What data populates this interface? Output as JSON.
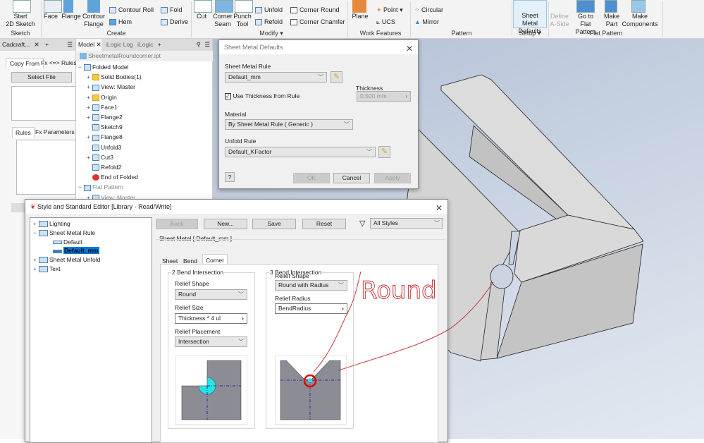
{
  "ribbon": {
    "sketch": {
      "start_label": "Start",
      "start_label2": "2D Sketch",
      "group": "Sketch"
    },
    "create": {
      "face": "Face",
      "flange": "Flange",
      "contour_flange": "Contour",
      "contour_flange2": "Flange",
      "contour_roll": "Contour Roll",
      "hem": "Hem",
      "fold": "Fold",
      "derive": "Derive",
      "group": "Create"
    },
    "modify": {
      "cut": "Cut",
      "corner_seam": "Corner",
      "corner_seam2": "Seam",
      "punch_tool": "Punch",
      "punch_tool2": "Tool",
      "unfold": "Unfold",
      "refold": "Refold",
      "corner_round": "Corner Round",
      "corner_chamfer": "Corner Chamfer",
      "group": "Modify ▾"
    },
    "work_features": {
      "plane": "Plane",
      "point": "Point",
      "ucs": "UCS",
      "group": "Work Features"
    },
    "pattern": {
      "circular": "Circular",
      "mirror": "Mirror",
      "group": "Pattern"
    },
    "setup": {
      "sheet_metal_defaults": "Sheet Metal",
      "sheet_metal_defaults2": "Defaults",
      "group": "Setup ▾"
    },
    "flat_pattern": {
      "define_a_side": "Define",
      "define_a_side2": "A-Side",
      "go_to": "Go to",
      "go_to2": "Flat Pattern",
      "make_part": "Make",
      "make_part2": "Part",
      "make_components": "Make",
      "make_components2": "Components",
      "group": "Flat Pattern"
    }
  },
  "left_panel": {
    "tab": "Cadcraft...",
    "copy_from": "Copy From",
    "fx_rules": "Fx <=> Rules",
    "select_file": "Select File",
    "rules": "Rules",
    "fx_parameters": "Fx Parameters"
  },
  "model_panel": {
    "tabs": [
      "Model",
      "iLogic Log",
      "iLogic"
    ],
    "file": "SheetmetalRoundcorner.ipt",
    "items": [
      {
        "pm": "−",
        "label": "Folded Model"
      },
      {
        "pm": "+",
        "label": "Solid Bodies(1)"
      },
      {
        "pm": "+",
        "label": "View: Master"
      },
      {
        "pm": "+",
        "label": "Origin"
      },
      {
        "pm": "+",
        "label": "Face1"
      },
      {
        "pm": "+",
        "label": "Flange2"
      },
      {
        "pm": "",
        "label": "Sketch9"
      },
      {
        "pm": "+",
        "label": "Flange8"
      },
      {
        "pm": "",
        "label": "Unfold3"
      },
      {
        "pm": "+",
        "label": "Cut3"
      },
      {
        "pm": "",
        "label": "Refold2"
      },
      {
        "pm": "",
        "label": "End of Folded"
      },
      {
        "pm": "−",
        "label": "Flat Pattern"
      },
      {
        "pm": "+",
        "label": "View: Master"
      }
    ]
  },
  "smd": {
    "title": "Sheet Metal Defaults",
    "rule_label": "Sheet Metal Rule",
    "rule_value": "Default_mm",
    "use_thickness": "Use Thickness from Rule",
    "use_thickness_checked": true,
    "thickness_label": "Thickness",
    "thickness_value": "0.500 mm",
    "material_label": "Material",
    "material_value": "By Sheet Metal Rule ( Generic )",
    "unfold_label": "Unfold Rule",
    "unfold_value": "Default_KFactor",
    "ok": "OK",
    "cancel": "Cancel",
    "apply": "Apply",
    "help": "?"
  },
  "sse": {
    "title": "Style and Standard Editor [Library - Read/Write]",
    "tree": [
      {
        "pm": "+",
        "label": "Lighting",
        "indent": 0
      },
      {
        "pm": "−",
        "label": "Sheet Metal Rule",
        "indent": 0
      },
      {
        "pm": "",
        "label": "Default",
        "indent": 1
      },
      {
        "pm": "",
        "label": "Default_mm",
        "indent": 1,
        "selected": true
      },
      {
        "pm": "+",
        "label": "Sheet Metal Unfold",
        "indent": 0
      },
      {
        "pm": "+",
        "label": "Text",
        "indent": 0
      }
    ],
    "back": "Back",
    "new": "New...",
    "save": "Save",
    "reset": "Reset",
    "filter": "All Styles",
    "section": "Sheet Metal [ Default_mm ]",
    "tabs": [
      "Sheet",
      "Bend",
      "Corner"
    ],
    "active_tab": "Corner",
    "two_bend": {
      "title": "2 Bend Intersection",
      "relief_shape_label": "Relief Shape",
      "relief_shape": "Round",
      "relief_size_label": "Relief Size",
      "relief_size": "Thickness * 4 ul",
      "relief_placement_label": "Relief Placement",
      "relief_placement": "Intersection"
    },
    "three_bend": {
      "title": "3 Bend Intersection",
      "relief_shape_label": "Relief Shape",
      "relief_shape": "Round with Radius",
      "relief_radius_label": "Relief Radius",
      "relief_radius": "BendRadius"
    }
  },
  "annotation": {
    "text": "Round",
    "color": "#c0282c"
  },
  "colors": {
    "accent": "#0078d7",
    "relief_cyan": "#22e5e8",
    "part_gray": "#8c8c94"
  }
}
